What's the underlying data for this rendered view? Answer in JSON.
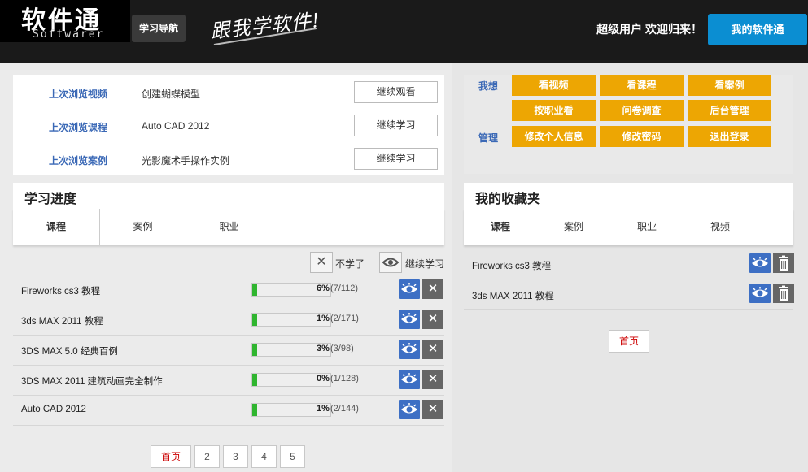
{
  "header": {
    "logo_cn": "软件通",
    "logo_en": "Softwarer",
    "nav_label": "学习导航",
    "slogan": "跟我学软件!",
    "welcome": "超级用户 欢迎归来！",
    "my_button": "我的软件通",
    "brand_color": "#0b8ed2"
  },
  "recent": [
    {
      "label": "上次浏览视频",
      "value": "创建蝴蝶模型",
      "button": "继续观看"
    },
    {
      "label": "上次浏览课程",
      "value": "Auto CAD 2012",
      "button": "继续学习"
    },
    {
      "label": "上次浏览案例",
      "value": "光影魔术手操作实例",
      "button": "继续学习"
    }
  ],
  "progress": {
    "title": "学习进度",
    "tabs": [
      "课程",
      "案例",
      "职业"
    ],
    "active_tab": "课程",
    "actions": {
      "quit": "不学了",
      "continue": "继续学习"
    },
    "rows": [
      {
        "name": "Fireworks cs3 教程",
        "percent_label": "6%",
        "percent": 6,
        "count": "(7/112)"
      },
      {
        "name": "3ds MAX 2011 教程",
        "percent_label": "1%",
        "percent": 1,
        "count": "(2/171)"
      },
      {
        "name": "3DS MAX 5.0 经典百例",
        "percent_label": "3%",
        "percent": 3,
        "count": "(3/98)"
      },
      {
        "name": "3DS MAX 2011 建筑动画完全制作",
        "percent_label": "0%",
        "percent": 0,
        "count": "(1/128)"
      },
      {
        "name": "Auto CAD 2012",
        "percent_label": "1%",
        "percent": 1,
        "count": "(2/144)"
      }
    ],
    "pager": [
      "首页",
      "2",
      "3",
      "4",
      "5"
    ]
  },
  "admin": {
    "label_me": "我想",
    "label_manage": "管理",
    "buttons": [
      "看视频",
      "看课程",
      "看案例",
      "按职业看",
      "问卷调查",
      "后台管理",
      "修改个人信息",
      "修改密码",
      "退出登录"
    ],
    "button_color": "#eda603"
  },
  "favorites": {
    "title": "我的收藏夹",
    "tabs": [
      "课程",
      "案例",
      "职业",
      "视频"
    ],
    "active_tab": "课程",
    "rows": [
      {
        "name": "Fireworks cs3 教程"
      },
      {
        "name": "3ds MAX 2011 教程"
      }
    ],
    "pager": [
      "首页"
    ]
  }
}
